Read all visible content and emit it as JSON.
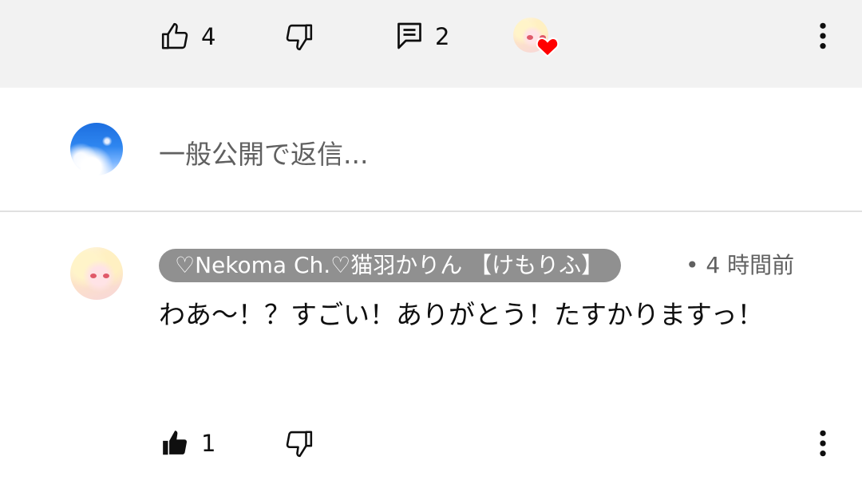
{
  "parent_actions": {
    "like_count": "4",
    "reply_count": "2"
  },
  "reply_box": {
    "placeholder": "一般公開で返信..."
  },
  "reply_comment": {
    "author": "♡Nekoma Ch.♡猫羽かりん 【けもりふ】",
    "timestamp": "• 4 時間前",
    "text": "わあ〜！？すごい！ありがとう！たすかりますっ！",
    "like_count": "1"
  },
  "icons": [
    "thumbs-up-icon",
    "thumbs-down-icon",
    "comment-icon",
    "heart-icon",
    "more-vert-icon"
  ],
  "colors": {
    "heart": "#ff0000",
    "chip_bg": "#909090",
    "top_bar_bg": "#f2f2f2"
  }
}
